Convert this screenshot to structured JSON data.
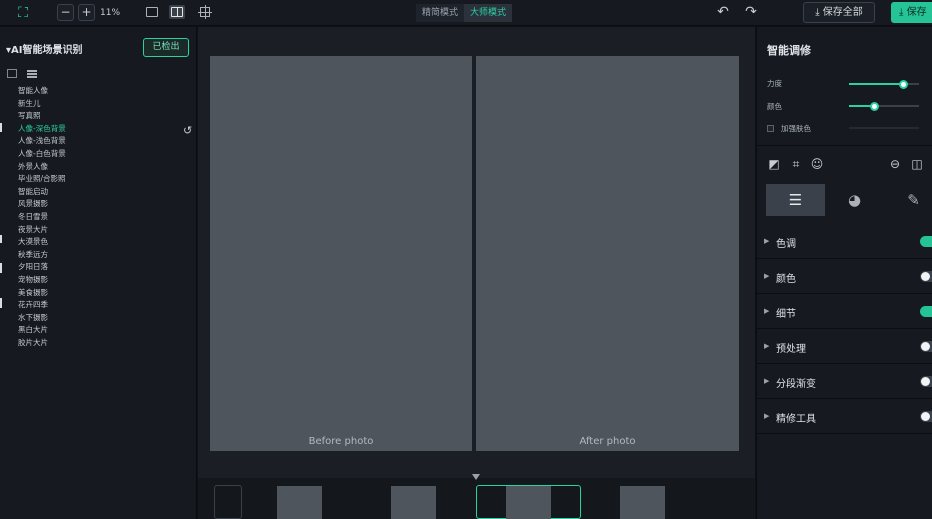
{
  "toolbar": {
    "logo_icon": "crop-frame-icon",
    "zoom_out": "−",
    "zoom_in": "+",
    "zoom_level": "11%",
    "modes": [
      "精简模式",
      "大师模式"
    ],
    "active_mode": "大师模式",
    "undo": "↶",
    "redo": "↷",
    "save_all": "保存全部",
    "save": "保存"
  },
  "left_panel": {
    "title": "AI智能场景识别",
    "detected_button": "已检出",
    "scenes": [
      "智能人像",
      "新生儿",
      "写真照",
      "人像-深色背景",
      "人像-浅色背景",
      "人像-白色背景",
      "外景人像",
      "毕业照/合影照",
      "智能启动",
      "风景摄影",
      "冬日雪景",
      "夜景大片",
      "大漠景色",
      "秋季远方",
      "夕阳日落",
      "宠物摄影",
      "美食摄影",
      "花卉四季",
      "水下摄影",
      "黑白大片",
      "胶片大片"
    ],
    "selected_scene": "人像-深色背景"
  },
  "center": {
    "before_label": "Before photo",
    "after_label": "After photo"
  },
  "right_panel": {
    "title": "智能调修",
    "sliders": [
      {
        "label": "力度",
        "value": 0.78
      },
      {
        "label": "颜色",
        "value": 0.36
      }
    ],
    "checkbox_label": "加强肤色",
    "sections": [
      {
        "label": "色调",
        "on": true
      },
      {
        "label": "颜色",
        "on": false
      },
      {
        "label": "细节",
        "on": true
      },
      {
        "label": "预处理",
        "on": false
      },
      {
        "label": "分段渐变",
        "on": false
      },
      {
        "label": "精修工具",
        "on": false
      }
    ]
  }
}
